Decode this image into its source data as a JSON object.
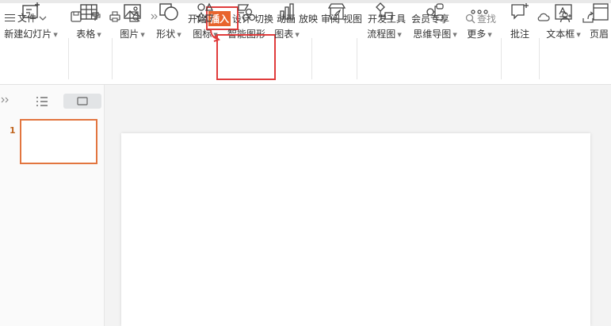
{
  "topbar": {
    "file_label": "文件",
    "tabs": [
      "开始",
      "插入",
      "设计",
      "切换",
      "动画",
      "放映",
      "审阅",
      "视图",
      "开发工具",
      "会员专享"
    ],
    "active_tab": "插入",
    "search_label": "查找"
  },
  "ribbon": {
    "items": [
      {
        "label": "新建幻灯片",
        "icon": "new-slide-icon",
        "has_caret": true
      },
      {
        "label": "表格",
        "icon": "table-icon",
        "has_caret": true
      },
      {
        "label": "图片",
        "icon": "picture-icon",
        "has_caret": true
      },
      {
        "label": "形状",
        "icon": "shapes-icon",
        "has_caret": true
      },
      {
        "label": "图标",
        "icon": "icons-icon",
        "has_caret": true
      },
      {
        "label": "智能图形",
        "icon": "smart-graphic-icon",
        "has_caret": false
      },
      {
        "label": "图表",
        "icon": "chart-icon",
        "has_caret": true
      },
      {
        "label": "",
        "icon": "material-icon",
        "has_caret": false
      },
      {
        "label": "流程图",
        "icon": "flowchart-icon",
        "has_caret": true
      },
      {
        "label": "思维导图",
        "icon": "mindmap-icon",
        "has_caret": true
      },
      {
        "label": "更多",
        "icon": "more-icon",
        "has_caret": true
      },
      {
        "label": "批注",
        "icon": "comment-icon",
        "has_caret": false
      },
      {
        "label": "文本框",
        "icon": "textbox-icon",
        "has_caret": true
      },
      {
        "label": "页眉",
        "icon": "header-icon",
        "has_caret": false
      }
    ]
  },
  "slides": {
    "current_number": "1"
  },
  "colors": {
    "accent": "#e8642d",
    "highlight": "#e03c3c",
    "thumb_border": "#e2753f"
  }
}
